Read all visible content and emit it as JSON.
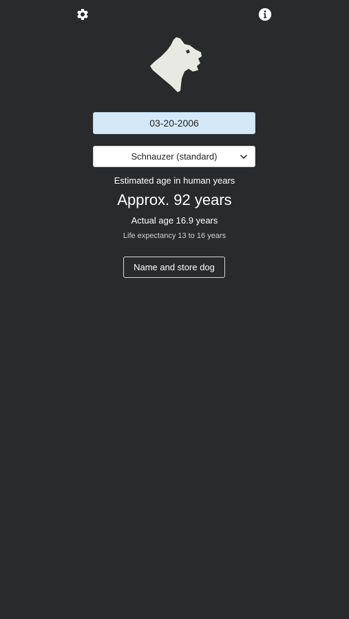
{
  "header": {
    "settings_icon": "gear-icon",
    "info_icon": "info-circle-icon"
  },
  "logo": {
    "icon": "schnauzer-head-icon"
  },
  "form": {
    "birthdate_value": "03-20-2006",
    "breed_selected": "Schnauzer (standard)",
    "breed_chevron_icon": "chevron-down-icon"
  },
  "result": {
    "estimated_label": "Estimated age in human years",
    "approx_text": "Approx. 92 years",
    "actual_age_text": "Actual age 16.9 years",
    "life_expectancy_text": "Life expectancy 13 to 16 years"
  },
  "actions": {
    "store_button_label": "Name and store dog"
  },
  "colors": {
    "background": "#292a2c",
    "date_field_bg": "#d4e8f8",
    "logo_fill": "#e9e9e4"
  }
}
